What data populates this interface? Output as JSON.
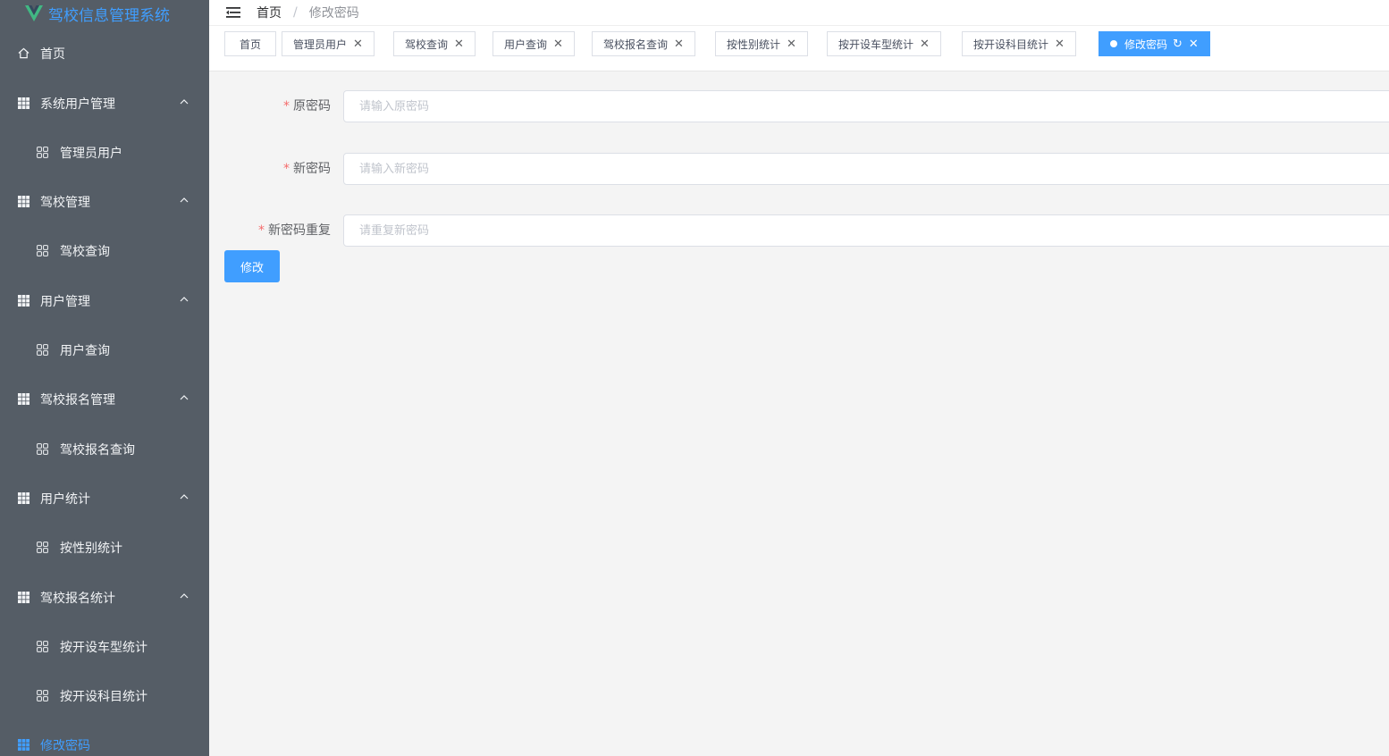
{
  "app": {
    "title": "驾校信息管理系统"
  },
  "colors": {
    "sidebar_bg": "#555d66",
    "accent": "#409eff",
    "required": "#f56c6c"
  },
  "sidebar": {
    "items": [
      {
        "label": "首页",
        "icon": "home-icon",
        "level": "top"
      },
      {
        "label": "系统用户管理",
        "icon": "grid-icon",
        "level": "top",
        "expanded": true
      },
      {
        "label": "管理员用户",
        "icon": "apps-icon",
        "level": "sub"
      },
      {
        "label": "驾校管理",
        "icon": "grid-icon",
        "level": "top",
        "expanded": true
      },
      {
        "label": "驾校查询",
        "icon": "apps-icon",
        "level": "sub"
      },
      {
        "label": "用户管理",
        "icon": "grid-icon",
        "level": "top",
        "expanded": true
      },
      {
        "label": "用户查询",
        "icon": "apps-icon",
        "level": "sub"
      },
      {
        "label": "驾校报名管理",
        "icon": "grid-icon",
        "level": "top",
        "expanded": true
      },
      {
        "label": "驾校报名查询",
        "icon": "apps-icon",
        "level": "sub"
      },
      {
        "label": "用户统计",
        "icon": "grid-icon",
        "level": "top",
        "expanded": true
      },
      {
        "label": "按性别统计",
        "icon": "apps-icon",
        "level": "sub"
      },
      {
        "label": "驾校报名统计",
        "icon": "grid-icon",
        "level": "top",
        "expanded": true
      },
      {
        "label": "按开设车型统计",
        "icon": "apps-icon",
        "level": "sub"
      },
      {
        "label": "按开设科目统计",
        "icon": "apps-icon",
        "level": "sub"
      },
      {
        "label": "修改密码",
        "icon": "grid-icon",
        "level": "top",
        "active": true
      }
    ]
  },
  "breadcrumb": {
    "home": "首页",
    "separator": "/",
    "current": "修改密码"
  },
  "tags": [
    {
      "label": "首页",
      "closable": false
    },
    {
      "label": "管理员用户",
      "closable": true
    },
    {
      "label": "驾校查询",
      "closable": true
    },
    {
      "label": "用户查询",
      "closable": true
    },
    {
      "label": "驾校报名查询",
      "closable": true
    },
    {
      "label": "按性别统计",
      "closable": true
    },
    {
      "label": "按开设车型统计",
      "closable": true
    },
    {
      "label": "按开设科目统计",
      "closable": true
    },
    {
      "label": "修改密码",
      "closable": true,
      "active": true
    }
  ],
  "form": {
    "old_password": {
      "label": "原密码",
      "placeholder": "请输入原密码",
      "value": ""
    },
    "new_password": {
      "label": "新密码",
      "placeholder": "请输入新密码",
      "value": ""
    },
    "repeat_password": {
      "label": "新密码重复",
      "placeholder": "请重复新密码",
      "value": ""
    },
    "submit_label": "修改",
    "required_mark": "*"
  },
  "icons": {
    "close": "✕",
    "refresh": "↻"
  }
}
